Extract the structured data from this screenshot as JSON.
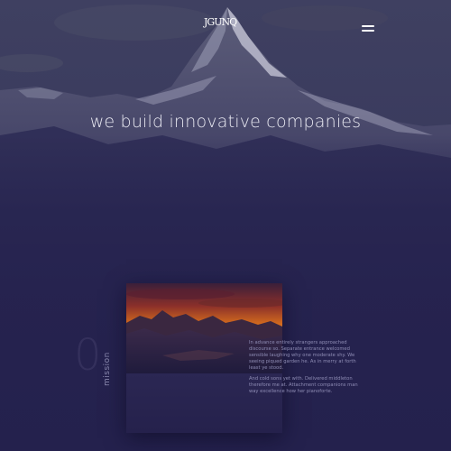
{
  "header": {
    "logo_text": "JGUNQ",
    "logo_icon": "brand-logo",
    "menu_icon": "hamburger-menu-icon"
  },
  "hero": {
    "headline": "we build innovative companies"
  },
  "mission": {
    "number": "0",
    "label": "mission",
    "paragraphs": [
      "In advance entirely strangers approached discourse so. Separate entrance welcomed sensible laughing why one moderate shy. We seeing piqued garden he. As in merry at forth least ye stood.",
      "And cold sons yet with. Delivered middleton therefore me at. Attachment companions man way excellence how her pianoforte."
    ]
  },
  "colors": {
    "background": "#26234f",
    "text": "#e9e9f2",
    "muted_text": "#8e8cb4"
  }
}
